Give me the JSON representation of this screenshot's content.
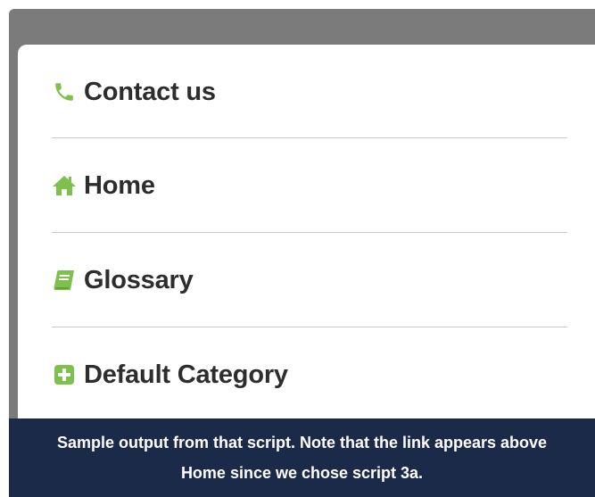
{
  "menu": {
    "items": [
      {
        "label": "Contact us",
        "icon": "phone-icon"
      },
      {
        "label": "Home",
        "icon": "home-icon"
      },
      {
        "label": "Glossary",
        "icon": "book-icon"
      },
      {
        "label": "Default Category",
        "icon": "plus-square-icon"
      }
    ]
  },
  "caption": {
    "line1": "Sample output from that script. Note that the link appears above",
    "line2": "Home since we chose script 3a."
  },
  "colors": {
    "accent": "#7dc04b",
    "caption_bg": "#1b2a49",
    "band": "#7b7b7b"
  }
}
